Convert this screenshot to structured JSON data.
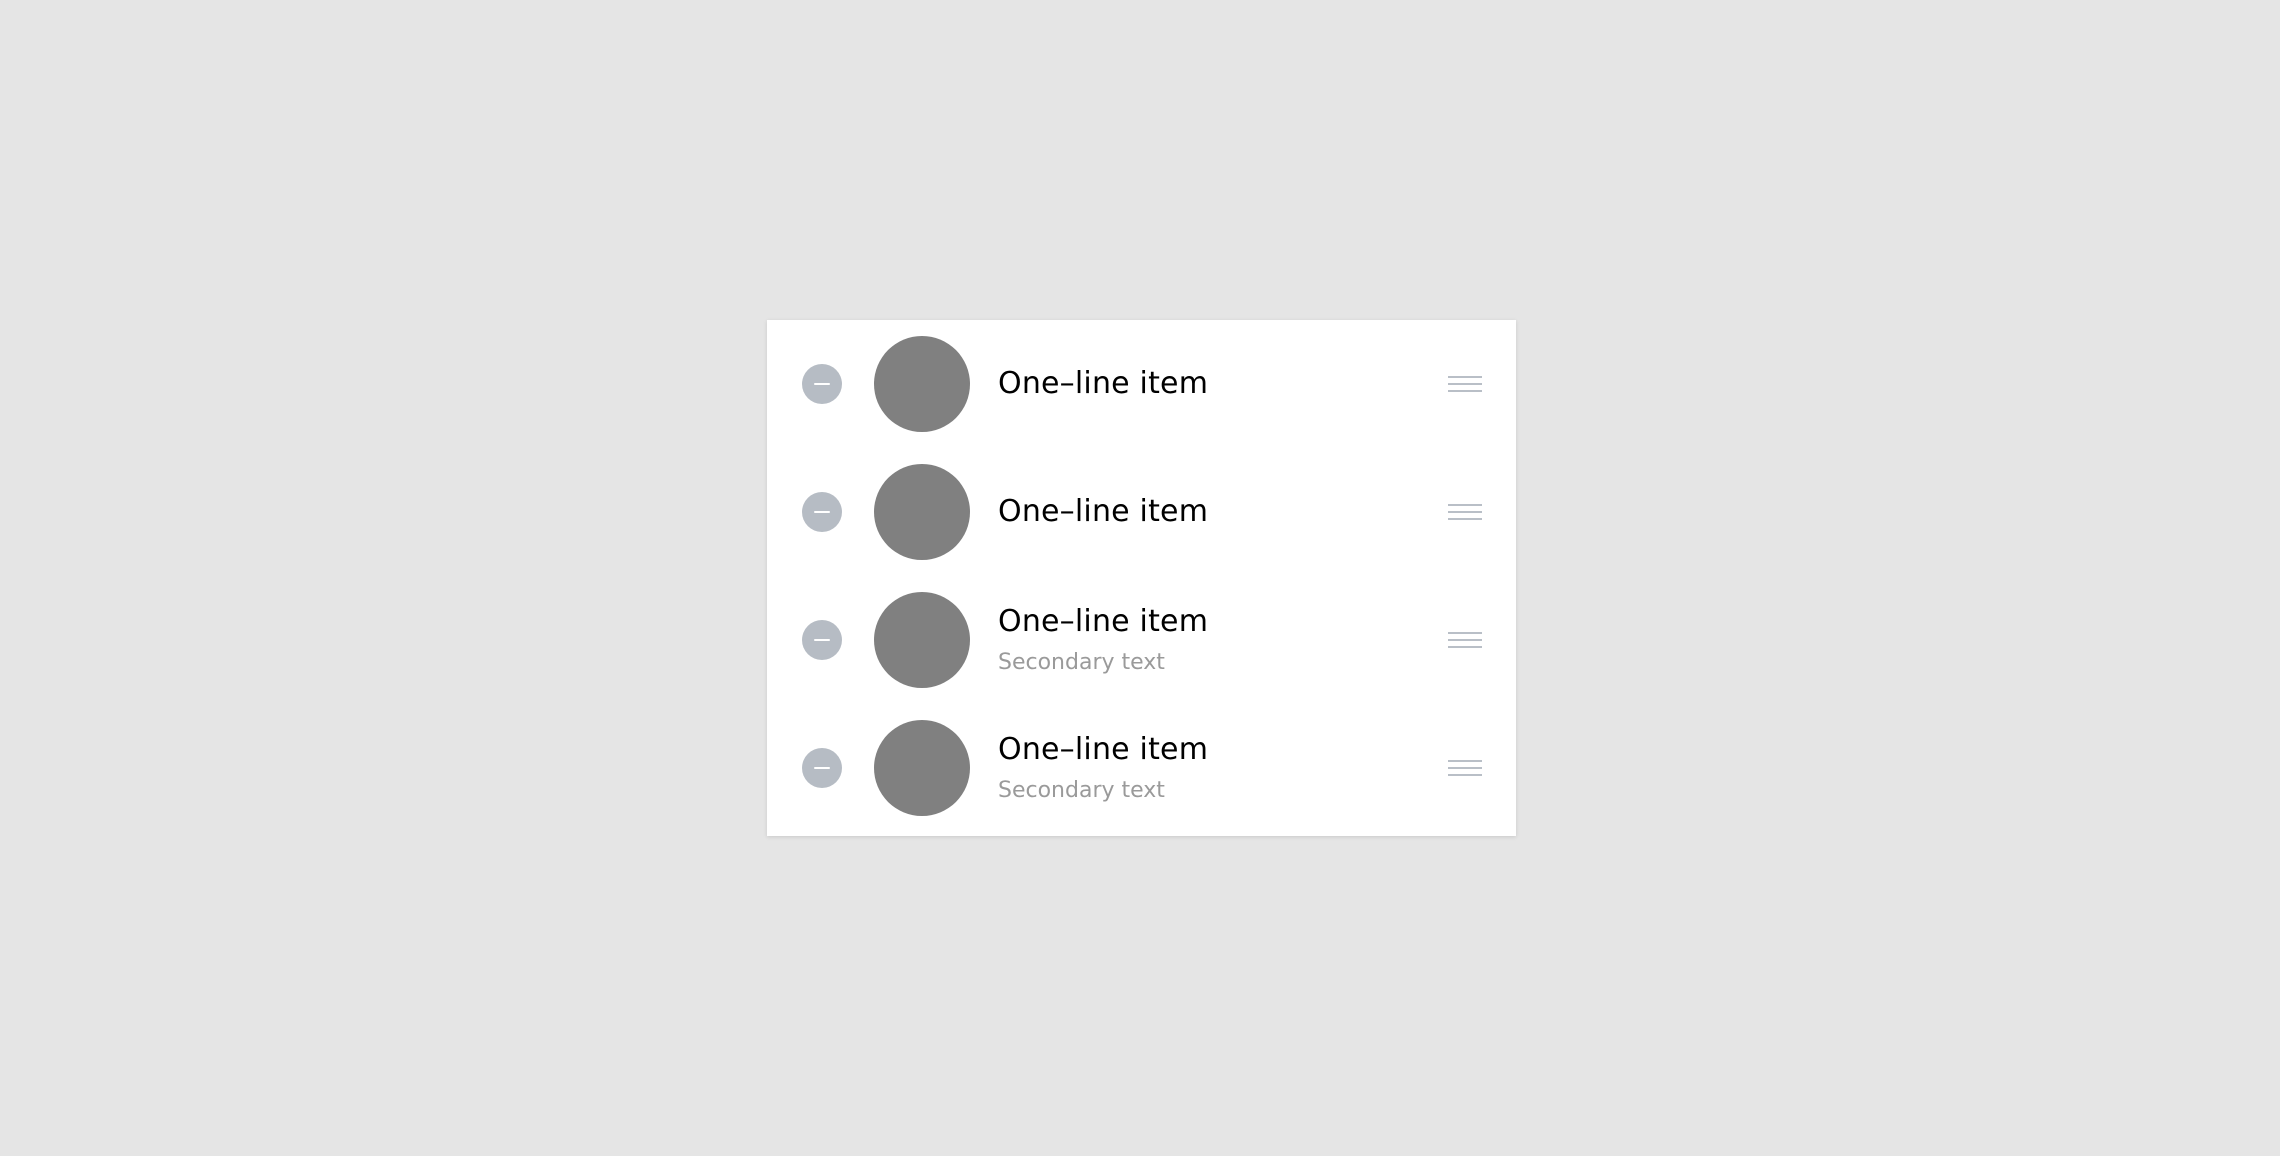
{
  "colors": {
    "background": "#e5e5e5",
    "card": "#ffffff",
    "remove_button": "#b6bcc4",
    "avatar": "#808080",
    "primary_text": "#000000",
    "secondary_text": "#9a9a9a",
    "drag_handle": "#b9bfc7"
  },
  "list": {
    "items": [
      {
        "primary": "One–line item",
        "secondary": ""
      },
      {
        "primary": "One–line item",
        "secondary": ""
      },
      {
        "primary": "One–line item",
        "secondary": "Secondary text"
      },
      {
        "primary": "One–line item",
        "secondary": "Secondary text"
      }
    ]
  }
}
